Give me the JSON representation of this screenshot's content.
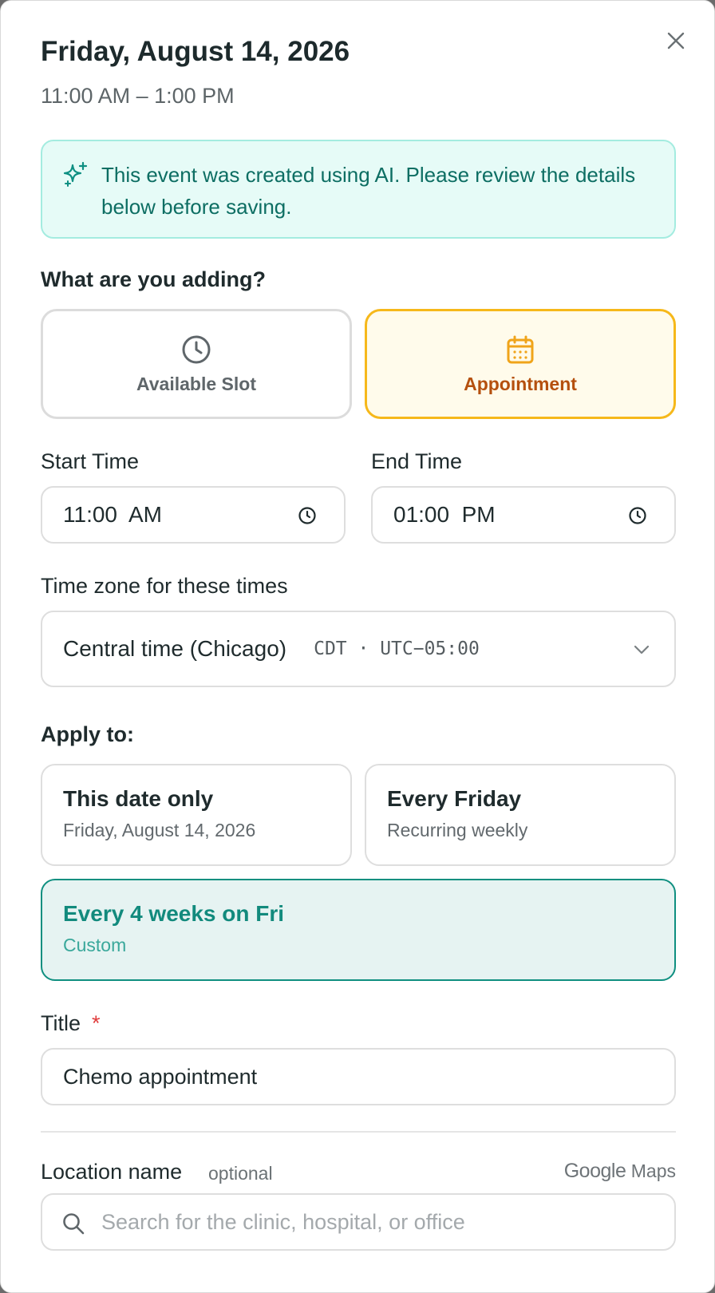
{
  "header": {
    "date": "Friday, August 14, 2026",
    "time_range": "11:00 AM – 1:00 PM"
  },
  "ai_banner": {
    "message": "This event was created using AI. Please review the details below before saving."
  },
  "event_type": {
    "question": "What are you adding?",
    "options": [
      {
        "label": "Available Slot",
        "icon": "clock-icon",
        "selected": false
      },
      {
        "label": "Appointment",
        "icon": "calendar-icon",
        "selected": true
      }
    ]
  },
  "times": {
    "start_label": "Start Time",
    "start_value": "11:00  AM",
    "end_label": "End Time",
    "end_value": "01:00  PM"
  },
  "timezone": {
    "label": "Time zone for these times",
    "name": "Central time (Chicago)",
    "code": "CDT · UTC−05:00"
  },
  "apply_to": {
    "label": "Apply to:",
    "options": [
      {
        "title": "This date only",
        "subtitle": "Friday, August 14, 2026",
        "selected": false
      },
      {
        "title": "Every Friday",
        "subtitle": "Recurring weekly",
        "selected": false
      },
      {
        "title": "Every 4 weeks on Fri",
        "subtitle": "Custom",
        "selected": true
      }
    ]
  },
  "title_field": {
    "label": "Title",
    "required_mark": "*",
    "value": "Chemo appointment"
  },
  "location": {
    "label": "Location name",
    "optional": "optional",
    "provider_google": "Google",
    "provider_maps": "Maps",
    "placeholder": "Search for the clinic, hospital, or office"
  },
  "colors": {
    "accent_teal": "#0f8f80",
    "accent_amber": "#f6b81a",
    "banner_bg": "#e6fbf7",
    "required_red": "#e03c3c"
  }
}
